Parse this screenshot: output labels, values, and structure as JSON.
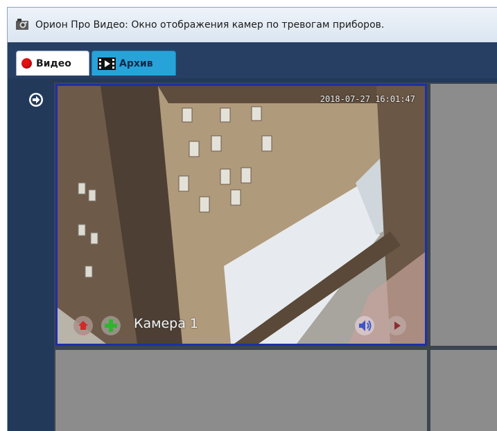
{
  "window": {
    "title": "Орион Про Видео: Окно отображения камер по тревогам приборов."
  },
  "tabs": [
    {
      "label": "Видео",
      "icon": "record-dot-icon",
      "active": true
    },
    {
      "label": "Архив",
      "icon": "film-icon",
      "active": false
    }
  ],
  "camera": {
    "name": "Камера 1",
    "timestamp": "2018-07-27 16:01:47"
  },
  "colors": {
    "tab_panel": "#263f63",
    "content_bg": "#22395a",
    "selected_border": "#1d2fa8",
    "archive_tab": "#27a3d9",
    "empty_cell": "#8c8c8c"
  }
}
